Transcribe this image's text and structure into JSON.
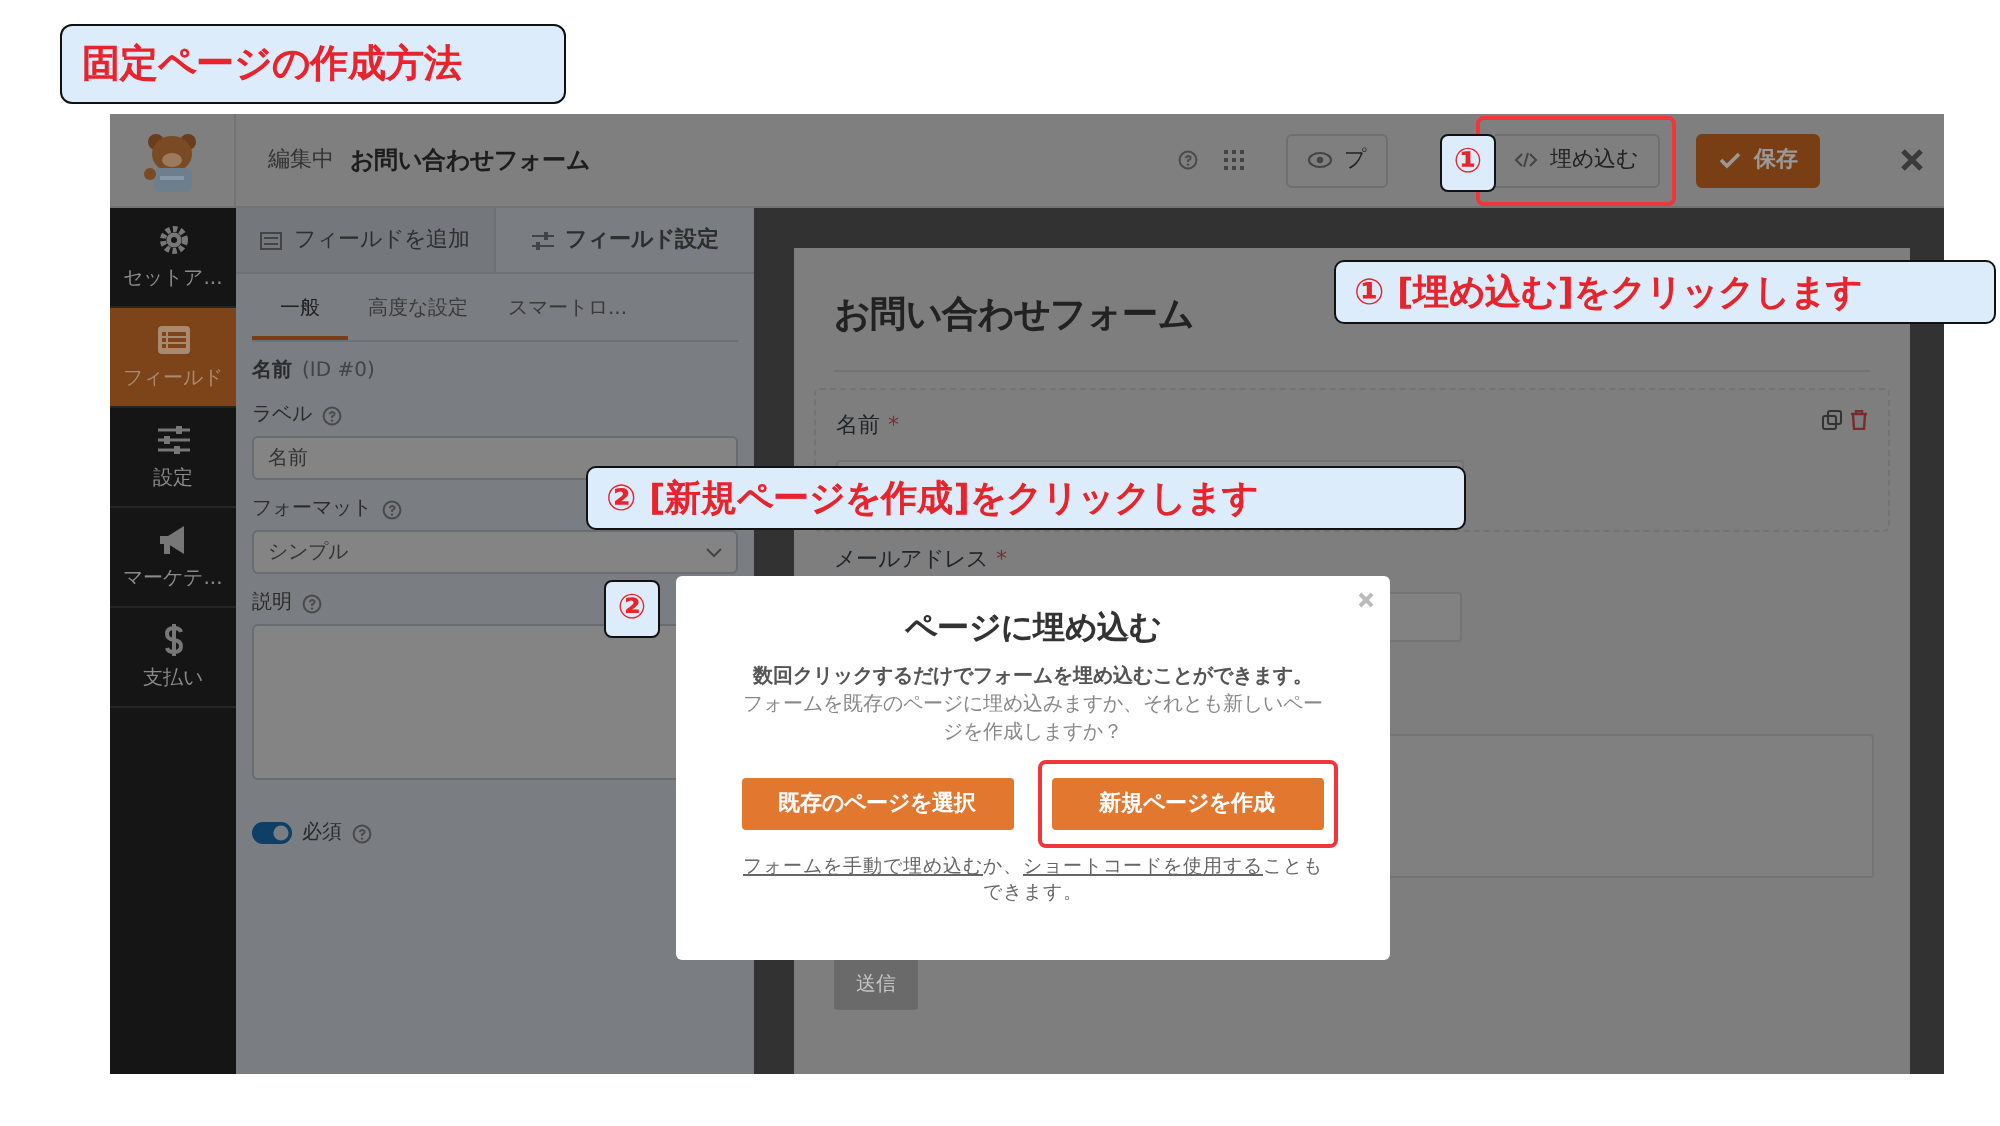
{
  "guide_title": "固定ページの作成方法",
  "header": {
    "editing_label": "編集中",
    "form_name": "お問い合わせフォーム",
    "buttons": [
      {
        "kind": "preview",
        "label": "プ",
        "highlighted": false
      },
      {
        "kind": "embed",
        "label": "埋め込む",
        "highlighted": true
      },
      {
        "kind": "save",
        "label": "保存",
        "highlighted": false
      }
    ]
  },
  "sidebar": {
    "items": [
      {
        "label": "セットア...",
        "selected": false
      },
      {
        "label": "フィールド",
        "selected": true
      },
      {
        "label": "設定",
        "selected": false
      },
      {
        "label": "マーケテ...",
        "selected": false
      },
      {
        "label": "支払い",
        "selected": false
      }
    ]
  },
  "panel": {
    "tabs": [
      {
        "label": "フィールドを追加",
        "selected": false
      },
      {
        "label": "フィールド設定",
        "selected": true
      }
    ],
    "subtabs": [
      {
        "label": "一般",
        "selected": true
      },
      {
        "label": "高度な設定",
        "selected": false
      },
      {
        "label": "スマートロ...",
        "selected": false
      }
    ],
    "field_title": "名前",
    "field_id": "(ID #0)",
    "label_label": "ラベル",
    "label_value": "名前",
    "format_label": "フォーマット",
    "format_value": "シンプル",
    "description_label": "説明",
    "required": {
      "label": "必須",
      "on": true
    }
  },
  "preview": {
    "title": "お問い合わせフォーム",
    "fields": [
      {
        "label": "名前",
        "required_mark": "*"
      },
      {
        "label": "メールアドレス",
        "required_mark": "*"
      }
    ],
    "submit": "送信"
  },
  "modal": {
    "title": "ページに埋め込む",
    "lead": "数回クリックするだけでフォームを埋め込むことができます。",
    "body": "フォームを既存のページに埋め込みますか、それとも新しいページを作成しますか？",
    "buttons": [
      {
        "label": "既存のページを選択",
        "highlighted": false
      },
      {
        "label": "新規ページを作成",
        "highlighted": true
      }
    ],
    "footer": [
      {
        "kind": "link",
        "text": "フォームを手動で埋め込む"
      },
      {
        "kind": "text",
        "text": "か、"
      },
      {
        "kind": "link",
        "text": "ショートコードを使用する"
      },
      {
        "kind": "text",
        "text": "こともできます。"
      }
    ]
  },
  "callouts": [
    {
      "text": "① [埋め込む]をクリックします"
    },
    {
      "text": "② [新規ページを作成]をクリックします"
    }
  ],
  "markers": [
    {
      "text": "①"
    },
    {
      "text": "②"
    }
  ]
}
